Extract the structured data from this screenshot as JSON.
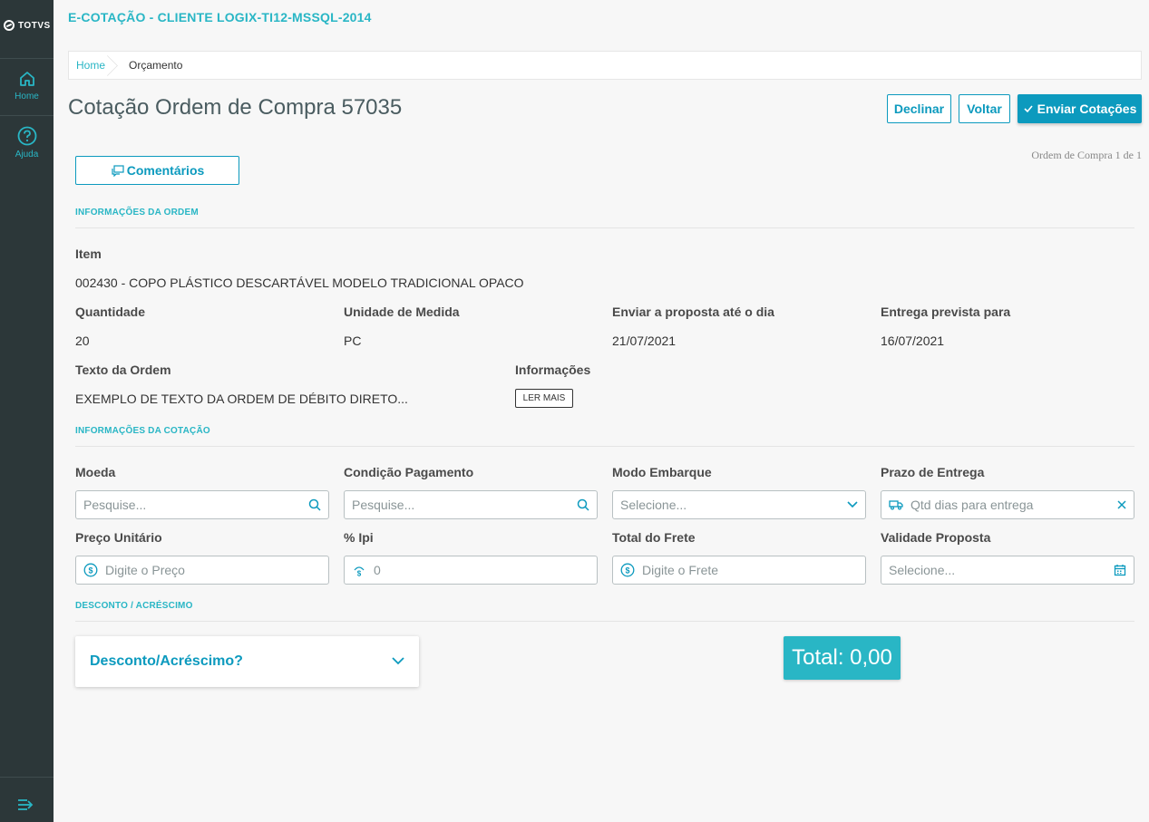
{
  "sidebar": {
    "logo_text": "TOTVS",
    "items": [
      {
        "label": "Home",
        "icon": "home-icon"
      },
      {
        "label": "Ajuda",
        "icon": "help-icon"
      }
    ],
    "collapse_icon": "collapse-menu-icon"
  },
  "header": {
    "app_title": "E-COTAÇÃO - CLIENTE LOGIX-TI12-MSSQL-2014",
    "breadcrumb": {
      "home": "Home",
      "current": "Orçamento"
    }
  },
  "page": {
    "title": "Cotação Ordem de Compra 57035",
    "actions": {
      "decline": "Declinar",
      "back": "Voltar",
      "send": "Enviar Cotações"
    },
    "pagination": "Ordem de Compra 1 de 1",
    "comments_button": "Comentários"
  },
  "order_info": {
    "section_title": "INFORMAÇÕES DA ORDEM",
    "item_label": "Item",
    "item_value": "002430 - COPO PLÁSTICO DESCARTÁVEL MODELO TRADICIONAL OPACO",
    "quantity_label": "Quantidade",
    "quantity_value": "20",
    "unit_label": "Unidade de Medida",
    "unit_value": "PC",
    "deadline_label": "Enviar a proposta até o dia",
    "deadline_value": "21/07/2021",
    "delivery_label": "Entrega prevista para",
    "delivery_value": "16/07/2021",
    "text_label": "Texto da Ordem",
    "text_value": "EXEMPLO DE TEXTO DA ORDEM DE DÉBITO DIRETO...",
    "info_label": "Informações",
    "read_more": "LER MAIS"
  },
  "quote_info": {
    "section_title": "INFORMAÇÕES DA COTAÇÃO",
    "currency": {
      "label": "Moeda",
      "placeholder": "Pesquise..."
    },
    "payment": {
      "label": "Condição Pagamento",
      "placeholder": "Pesquise..."
    },
    "shipping": {
      "label": "Modo Embarque",
      "placeholder": "Selecione..."
    },
    "lead_time": {
      "label": "Prazo de Entrega",
      "placeholder": "Qtd dias para entrega"
    },
    "unit_price": {
      "label": "Preço Unitário",
      "placeholder": "Digite o Preço"
    },
    "ipi": {
      "label": "% Ipi",
      "placeholder": "0"
    },
    "freight": {
      "label": "Total do Frete",
      "placeholder": "Digite o Frete"
    },
    "validity": {
      "label": "Validade Proposta",
      "placeholder": "Selecione..."
    }
  },
  "discount": {
    "section_title": "DESCONTO / ACRÉSCIMO",
    "accordion_title": "Desconto/Acréscimo?",
    "total": "Total: 0,00"
  },
  "colors": {
    "sidebar_bg": "#2c3739",
    "accent": "#29b6c5",
    "primary": "#0c9abe"
  }
}
